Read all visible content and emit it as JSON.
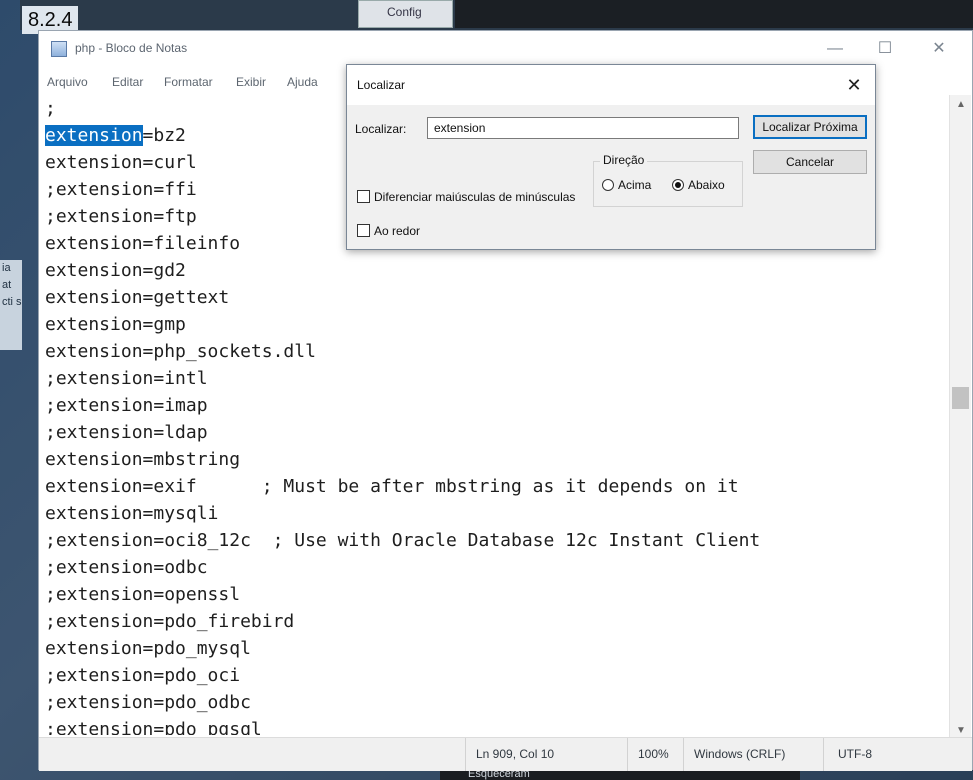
{
  "background": {
    "version_text": "8.2.4",
    "config_label": "Config",
    "side_text": "ia at cti s",
    "bottom_text": "Esqueceram"
  },
  "window": {
    "title": "php - Bloco de Notas",
    "controls": {
      "minimize": "—",
      "maximize": "☐",
      "close": "✕"
    }
  },
  "menu": {
    "items": [
      "Arquivo",
      "Editar",
      "Formatar",
      "Exibir",
      "Ajuda"
    ]
  },
  "editor": {
    "highlight_term": "extension",
    "lines": [
      ";",
      "extension=bz2",
      "extension=curl",
      ";extension=ffi",
      ";extension=ftp",
      "extension=fileinfo",
      "extension=gd2",
      "extension=gettext",
      "extension=gmp",
      "extension=php_sockets.dll",
      ";extension=intl",
      ";extension=imap",
      ";extension=ldap",
      "extension=mbstring",
      "extension=exif      ; Must be after mbstring as it depends on it",
      "extension=mysqli",
      ";extension=oci8_12c  ; Use with Oracle Database 12c Instant Client",
      ";extension=odbc",
      ";extension=openssl",
      ";extension=pdo_firebird",
      "extension=pdo_mysql",
      ";extension=pdo_oci",
      ";extension=pdo_odbc",
      ";extension=pdo_pgsql"
    ]
  },
  "statusbar": {
    "position": "Ln 909, Col 10",
    "zoom": "100%",
    "line_ending": "Windows (CRLF)",
    "encoding": "UTF-8"
  },
  "find_dialog": {
    "title": "Localizar",
    "find_label": "Localizar:",
    "find_value": "extension",
    "find_next_button": "Localizar Próxima",
    "cancel_button": "Cancelar",
    "direction_label": "Direção",
    "up_label": "Acima",
    "down_label": "Abaixo",
    "selected_direction": "down",
    "match_case_label": "Diferenciar maiúsculas de minúsculas",
    "match_case_checked": false,
    "wrap_label": "Ao redor",
    "wrap_checked": false
  }
}
